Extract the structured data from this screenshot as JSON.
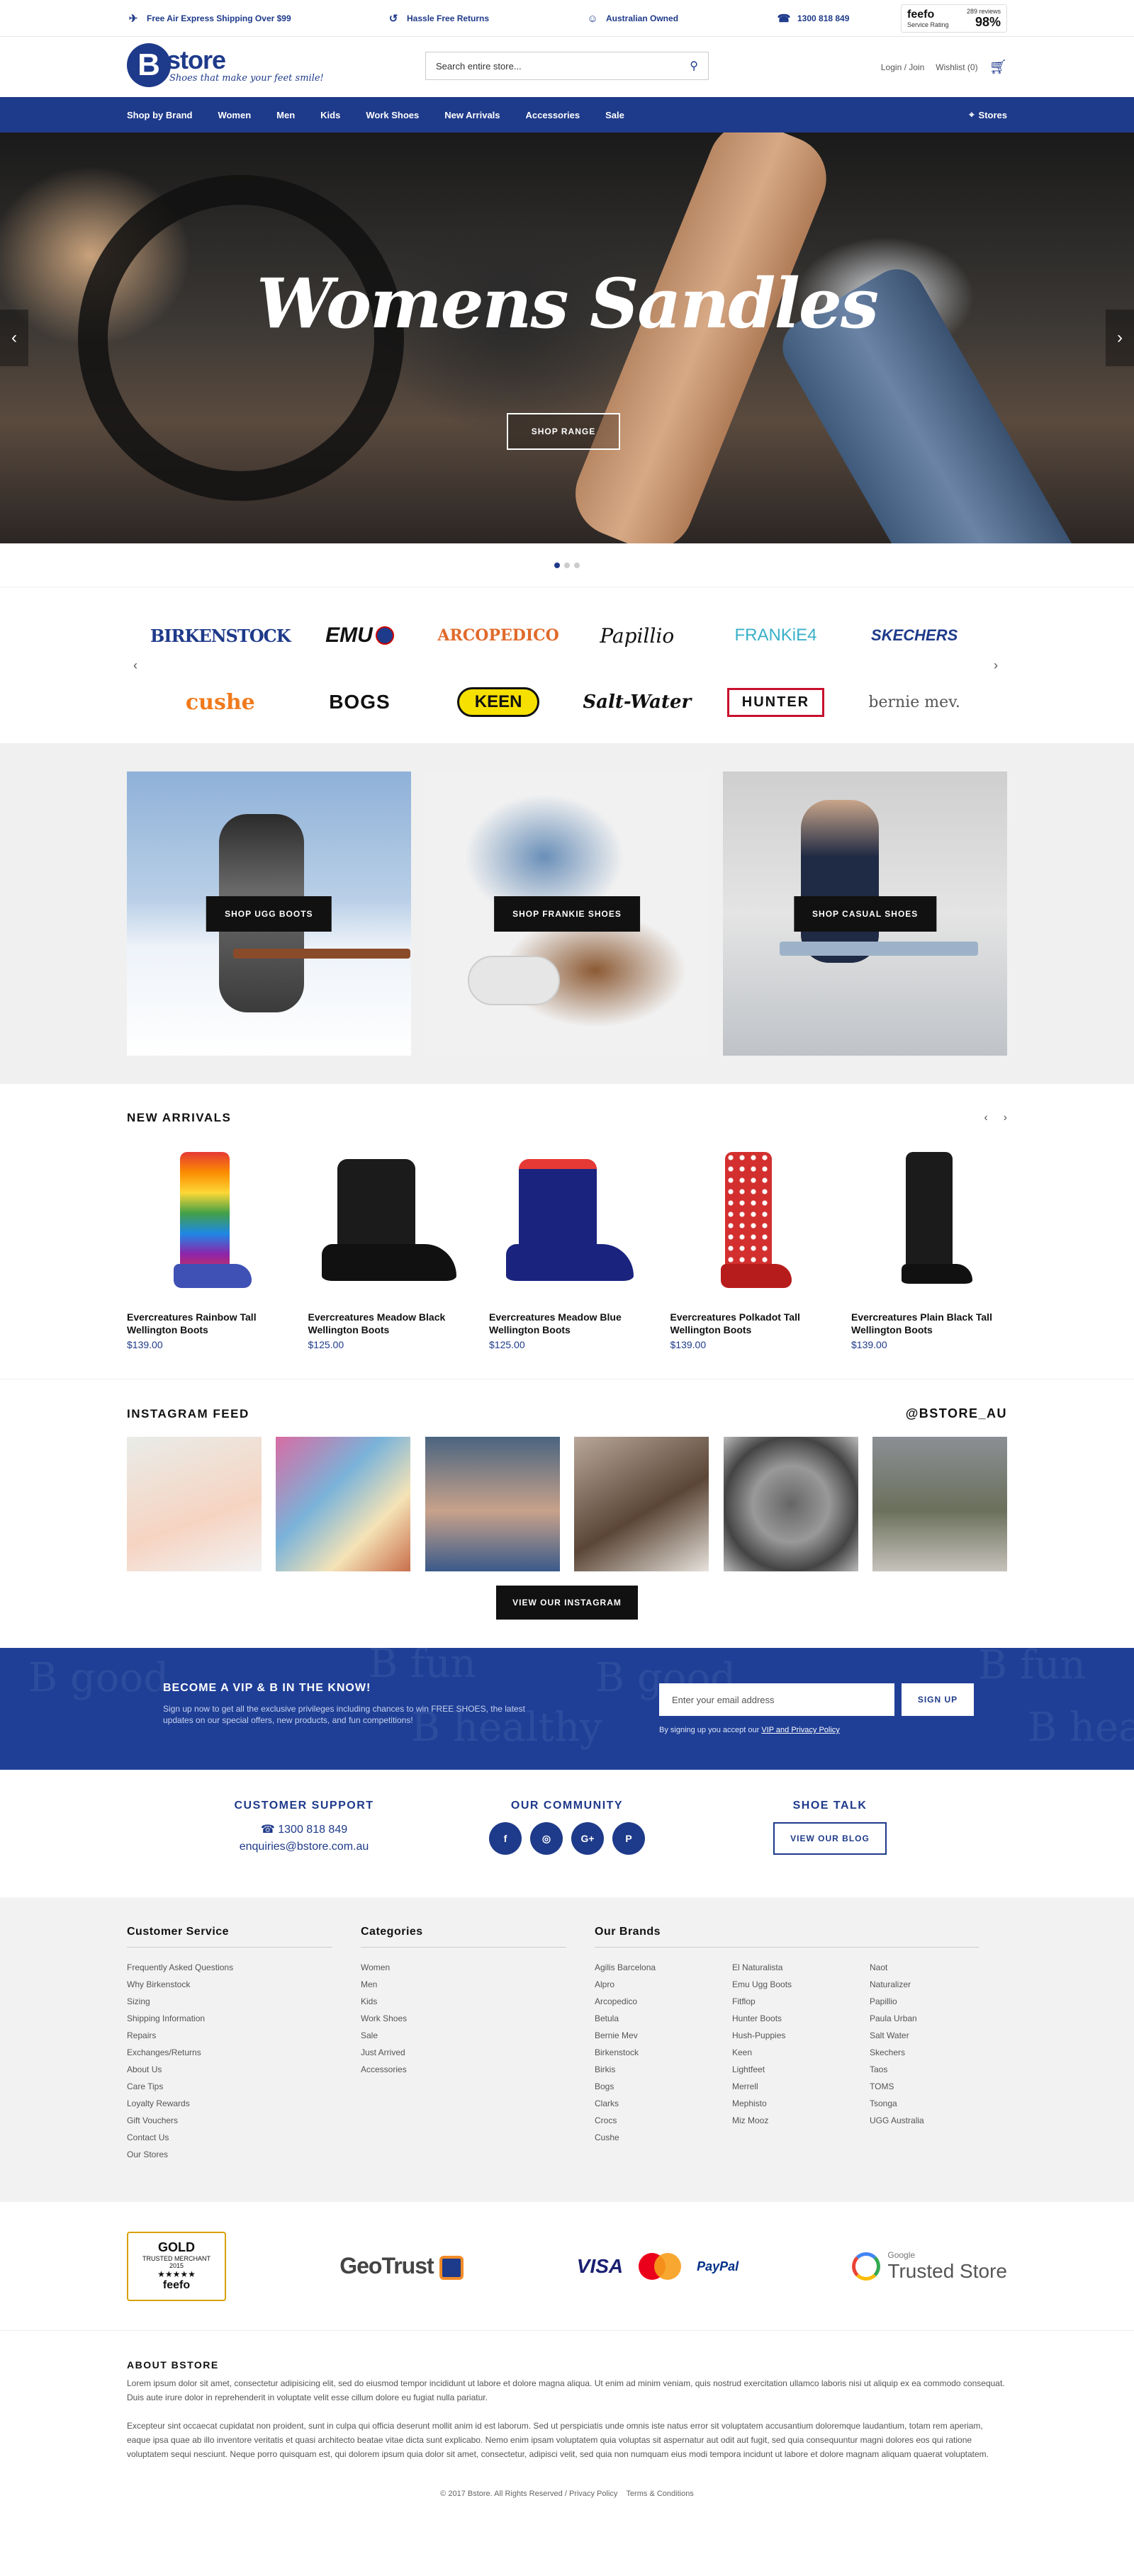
{
  "topbar": {
    "items": [
      {
        "icon": "plane-icon",
        "label": "Free Air Express Shipping Over $99"
      },
      {
        "icon": "returns-icon",
        "label": "Hassle Free Returns"
      },
      {
        "icon": "koala-icon",
        "label": "Australian Owned"
      },
      {
        "icon": "phone-icon",
        "label": "1300 818 849"
      }
    ],
    "feefo": {
      "brand": "feefo",
      "sub": "Service Rating",
      "reviews": "289 reviews",
      "percent": "98%"
    }
  },
  "header": {
    "logo_letter": "B",
    "logo_name": "store",
    "tagline": "Shoes that make your feet smile!",
    "search_placeholder": "Search entire store...",
    "login": "Login / Join",
    "wishlist": "Wishlist (0)"
  },
  "nav": {
    "items": [
      "Shop by Brand",
      "Women",
      "Men",
      "Kids",
      "Work Shoes",
      "New Arrivals",
      "Accessories",
      "Sale"
    ],
    "stores": "Stores"
  },
  "hero": {
    "title": "Womens Sandles",
    "cta": "SHOP RANGE"
  },
  "brands": [
    "BIRKENSTOCK",
    "EMU",
    "ARCOPEDICO",
    "Papillio",
    "FRANKiE4",
    "SKECHERS",
    "cushe",
    "BOGS",
    "KEEN",
    "Salt-Water",
    "HUNTER",
    "bernie mev."
  ],
  "tiles": [
    "SHOP UGG BOOTS",
    "SHOP FRANKIE SHOES",
    "SHOP CASUAL SHOES"
  ],
  "arrivals": {
    "title": "NEW ARRIVALS",
    "products": [
      {
        "name": "Evercreatures Rainbow Tall Wellington Boots",
        "price": "$139.00"
      },
      {
        "name": "Evercreatures Meadow Black Wellington Boots",
        "price": "$125.00"
      },
      {
        "name": "Evercreatures Meadow Blue Wellington Boots",
        "price": "$125.00"
      },
      {
        "name": "Evercreatures Polkadot Tall Wellington Boots",
        "price": "$139.00"
      },
      {
        "name": "Evercreatures Plain Black Tall Wellington Boots",
        "price": "$139.00"
      }
    ]
  },
  "instagram": {
    "title": "INSTAGRAM FEED",
    "handle": "@BSTORE_AU",
    "button": "VIEW OUR INSTAGRAM"
  },
  "vip": {
    "title": "BECOME A VIP & B IN THE KNOW!",
    "text": "Sign up now to get all the exclusive privileges including chances to win FREE SHOES, the latest updates on our special offers, new products, and fun competitions!",
    "placeholder": "Enter your email address",
    "button": "SIGN UP",
    "note": "By signing up you accept our",
    "note_link": "VIP and Privacy Policy",
    "bg_words": [
      "B good",
      "B fun",
      "B healthy",
      "B good",
      "B fun",
      "B healthy"
    ]
  },
  "support": {
    "customer_title": "CUSTOMER SUPPORT",
    "phone": "1300 818 849",
    "email": "enquiries@bstore.com.au",
    "community_title": "OUR COMMUNITY",
    "socials": [
      "f",
      "◎",
      "G+",
      "P"
    ],
    "shoetalk_title": "SHOE TALK",
    "blog_button": "VIEW OUR BLOG"
  },
  "footer": {
    "customer_service": {
      "title": "Customer Service",
      "links": [
        "Frequently Asked Questions",
        "Why Birkenstock",
        "Sizing",
        "Shipping Information",
        "Repairs",
        "Exchanges/Returns",
        "About Us",
        "Care Tips",
        "Loyalty Rewards",
        "Gift Vouchers",
        "Contact Us",
        "Our Stores"
      ]
    },
    "categories": {
      "title": "Categories",
      "links": [
        "Women",
        "Men",
        "Kids",
        "Work Shoes",
        "Sale",
        "Just Arrived",
        "Accessories"
      ]
    },
    "brands": {
      "title": "Our Brands",
      "col1": [
        "Agilis Barcelona",
        "Alpro",
        "Arcopedico",
        "Betula",
        "Bernie Mev",
        "Birkenstock",
        "Birkis",
        "Bogs",
        "Clarks",
        "Crocs",
        "Cushe"
      ],
      "col2": [
        "El Naturalista",
        "Emu Ugg Boots",
        "Fitflop",
        "Hunter Boots",
        "Hush-Puppies",
        "Keen",
        "Lightfeet",
        "Merrell",
        "Mephisto",
        "Miz Mooz"
      ],
      "col3": [
        "Naot",
        "Naturalizer",
        "Papillio",
        "Paula Urban",
        "Salt Water",
        "Skechers",
        "Taos",
        "TOMS",
        "Tsonga",
        "UGG Australia"
      ]
    }
  },
  "trust": {
    "gold_title": "GOLD",
    "gold_sub": "TRUSTED MERCHANT",
    "gold_year": "2015",
    "gold_stars": "★★★★★",
    "gold_brand": "feefo",
    "geotrust": "GeoTrust",
    "visa": "VISA",
    "mastercard": "MasterCard",
    "paypal": "PayPal",
    "google_small": "Google",
    "google_big": "Trusted Store"
  },
  "about": {
    "title": "ABOUT BSTORE",
    "p1": "Lorem ipsum dolor sit amet, consectetur adipisicing elit, sed do eiusmod tempor incididunt ut labore et dolore magna aliqua. Ut enim ad minim veniam, quis nostrud exercitation ullamco laboris nisi ut aliquip ex ea commodo consequat. Duis aute irure dolor in reprehenderit in voluptate velit esse cillum dolore eu fugiat nulla pariatur.",
    "p2": "Excepteur sint occaecat cupidatat non proident, sunt in culpa qui officia deserunt mollit anim id est laborum. Sed ut perspiciatis unde omnis iste natus error sit voluptatem accusantium doloremque laudantium, totam rem aperiam, eaque ipsa quae ab illo inventore veritatis et quasi architecto beatae vitae dicta sunt explicabo. Nemo enim ipsam voluptatem quia voluptas sit aspernatur aut odit aut fugit, sed quia consequuntur magni dolores eos qui ratione voluptatem sequi nesciunt. Neque porro quisquam est, qui dolorem ipsum quia dolor sit amet, consectetur, adipisci velit, sed quia non numquam eius modi tempora incidunt ut labore et dolore magnam aliquam quaerat voluptatem.",
    "copyright": "© 2017 Bstore. All Rights Reserved",
    "privacy": "Privacy Policy",
    "terms": "Terms & Conditions"
  },
  "colors": {
    "brand": "#1e3a8a",
    "vip_bg": "#1f3f97"
  }
}
